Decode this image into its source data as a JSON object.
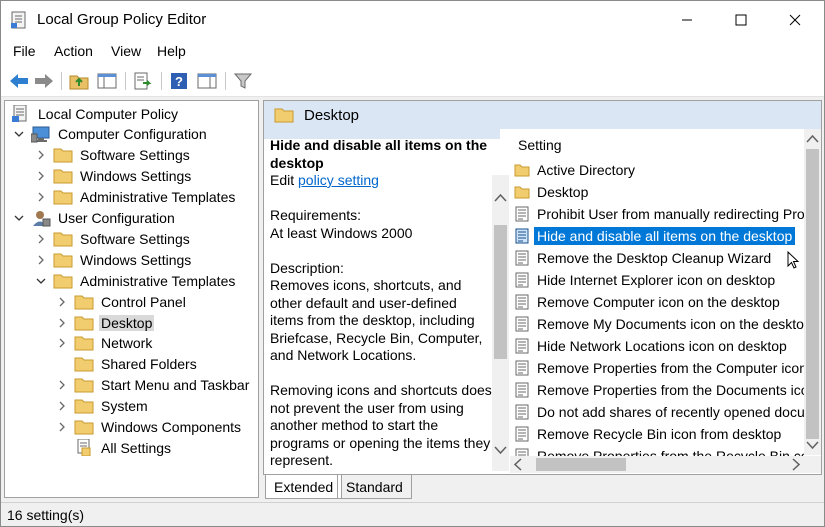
{
  "window": {
    "title": "Local Group Policy Editor"
  },
  "menu": [
    "File",
    "Action",
    "View",
    "Help"
  ],
  "tree": [
    {
      "label": "Local Computer Policy",
      "level": 0,
      "chevron": "none",
      "icon": "computer-policy-icon"
    },
    {
      "label": "Computer Configuration",
      "level": 1,
      "chevron": "expanded",
      "icon": "computer-icon"
    },
    {
      "label": "Software Settings",
      "level": 2,
      "chevron": "collapsed",
      "icon": "folder-icon"
    },
    {
      "label": "Windows Settings",
      "level": 2,
      "chevron": "collapsed",
      "icon": "folder-icon"
    },
    {
      "label": "Administrative Templates",
      "level": 2,
      "chevron": "collapsed",
      "icon": "folder-icon"
    },
    {
      "label": "User Configuration",
      "level": 1,
      "chevron": "expanded",
      "icon": "user-icon"
    },
    {
      "label": "Software Settings",
      "level": 2,
      "chevron": "collapsed",
      "icon": "folder-icon"
    },
    {
      "label": "Windows Settings",
      "level": 2,
      "chevron": "collapsed",
      "icon": "folder-icon"
    },
    {
      "label": "Administrative Templates",
      "level": 2,
      "chevron": "expanded",
      "icon": "folder-icon"
    },
    {
      "label": "Control Panel",
      "level": 3,
      "chevron": "collapsed",
      "icon": "folder-icon"
    },
    {
      "label": "Desktop",
      "level": 3,
      "chevron": "collapsed",
      "icon": "folder-icon",
      "selected": true
    },
    {
      "label": "Network",
      "level": 3,
      "chevron": "collapsed",
      "icon": "folder-icon"
    },
    {
      "label": "Shared Folders",
      "level": 3,
      "chevron": "none",
      "icon": "folder-icon"
    },
    {
      "label": "Start Menu and Taskbar",
      "level": 3,
      "chevron": "collapsed",
      "icon": "folder-icon"
    },
    {
      "label": "System",
      "level": 3,
      "chevron": "collapsed",
      "icon": "folder-icon"
    },
    {
      "label": "Windows Components",
      "level": 3,
      "chevron": "collapsed",
      "icon": "folder-icon"
    },
    {
      "label": "All Settings",
      "level": 3,
      "chevron": "none",
      "icon": "all-settings-icon"
    }
  ],
  "right_pane": {
    "header": "Desktop",
    "description": {
      "title": "Hide and disable all items on the desktop",
      "edit_prefix": "Edit",
      "edit_link": "policy setting",
      "requirements_label": "Requirements:",
      "requirements_value": "At least Windows 2000",
      "description_label": "Description:",
      "description_text": "Removes icons, shortcuts, and other default and user-defined items from the desktop, including Briefcase, Recycle Bin, Computer, and Network Locations.",
      "extra_text": "Removing icons and shortcuts does not prevent the user from using another method to start the programs or opening the items they represent."
    },
    "column_header": "Setting",
    "settings": [
      {
        "label": "Active Directory",
        "icon": "folder-icon"
      },
      {
        "label": "Desktop",
        "icon": "folder-icon"
      },
      {
        "label": "Prohibit User from manually redirecting Prof",
        "icon": "policy-setting-icon"
      },
      {
        "label": "Hide and disable all items on the desktop",
        "icon": "policy-setting-icon",
        "selected": true
      },
      {
        "label": "Remove the Desktop Cleanup Wizard",
        "icon": "policy-setting-icon"
      },
      {
        "label": "Hide Internet Explorer icon on desktop",
        "icon": "policy-setting-icon"
      },
      {
        "label": "Remove Computer icon on the desktop",
        "icon": "policy-setting-icon"
      },
      {
        "label": "Remove My Documents icon on the desktop",
        "icon": "policy-setting-icon"
      },
      {
        "label": "Hide Network Locations icon on desktop",
        "icon": "policy-setting-icon"
      },
      {
        "label": "Remove Properties from the Computer icon c",
        "icon": "policy-setting-icon"
      },
      {
        "label": "Remove Properties from the Documents icor",
        "icon": "policy-setting-icon"
      },
      {
        "label": "Do not add shares of recently opened docur",
        "icon": "policy-setting-icon"
      },
      {
        "label": "Remove Recycle Bin icon from desktop",
        "icon": "policy-setting-icon"
      },
      {
        "label": "Remove Properties from the Recycle Bin con",
        "icon": "policy-setting-icon"
      }
    ]
  },
  "tabs": [
    "Extended",
    "Standard"
  ],
  "status": "16 setting(s)",
  "colors": {
    "selection": "#0078d7",
    "header_band": "#dbe6f4",
    "link": "#0066cc"
  }
}
